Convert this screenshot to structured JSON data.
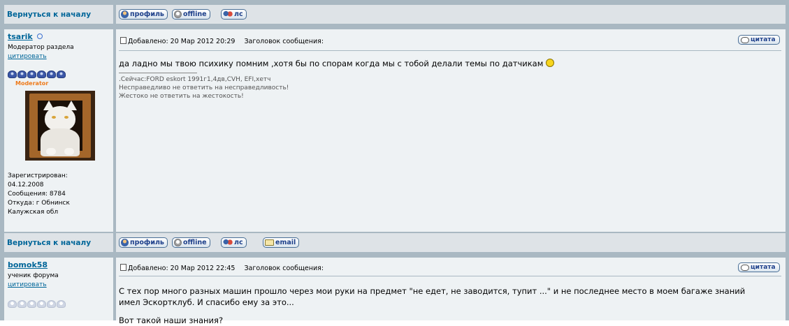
{
  "nav": {
    "back_to_top": "Вернуться к началу"
  },
  "buttons": {
    "profile": "профиль",
    "offline": "offline",
    "pm": "лс",
    "email": "email",
    "quote": "цитата"
  },
  "post1": {
    "author": "tsarik",
    "rank": "Модератор раздела",
    "quote_user": "цитировать",
    "rank_badge": "Moderator",
    "stars_filled": 6,
    "registered_label": "Зарегистрирован:",
    "registered_date": "04.12.2008",
    "messages": "Сообщения: 8784",
    "from": "Откуда: г Обнинск",
    "region": "Калужская обл",
    "posted": "Добавлено: 20 Мар 2012 20:29",
    "subject_label": "Заголовок сообщения:",
    "text": "да ладно мы твою психику помним ,хотя бы по спорам когда мы с тобой делали темы по датчикам",
    "sig_1": ".Сейчас:FORD eskort 1991г1,4дв,CVH, EFI,хетч",
    "sig_2": "Несправедливо не ответить на несправедливость!",
    "sig_3": "Жестоко не ответить на жестокость!"
  },
  "post2": {
    "author": "bomok58",
    "rank": "ученик форума",
    "quote_user": "цитировать",
    "stars_filled": 0,
    "posted": "Добавлено: 20 Мар 2012 22:45",
    "subject_label": "Заголовок сообщения:",
    "text": "С тех пор много разных машин прошло через мои руки на предмет \"не едет, не заводится, тупит ...\" и не последнее место в моем багаже знаний имел Эскортклуб. И спасибо ему за это...",
    "text_cut": "Вот такой наши знания?"
  },
  "colors": {
    "link": "#006699",
    "row_light": "#eef2f4",
    "row_mid": "#dee3e7",
    "border": "#a9b8c2",
    "moderator": "#ee7a1a"
  }
}
